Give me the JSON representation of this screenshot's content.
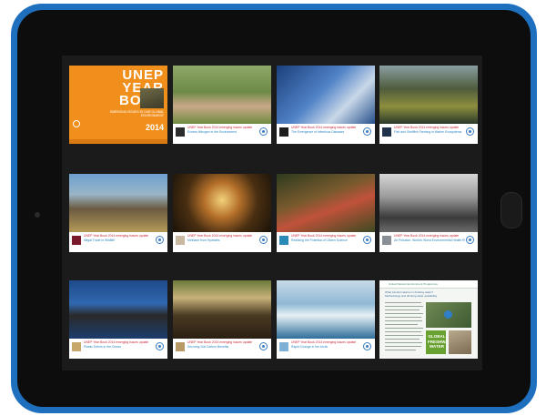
{
  "colors": {
    "frame": "#1f6fbf",
    "bezel": "#0d0d0d",
    "screen": "#1b1b1b",
    "cover": "#f08f1c",
    "caption_red": "#c9283a",
    "caption_blue": "#2e86c1"
  },
  "cover": {
    "title_lines": [
      "UNEP",
      "YEAR",
      "BOOK"
    ],
    "subtitle": "EMERGING ISSUES IN OUR GLOBAL ENVIRONMENT",
    "year": "2014"
  },
  "tiles": [
    {
      "series": "UNEP Year Book 2014 emerging issues update",
      "topic": "Excess Nitrogen in the Environment",
      "accent": "#2b2b2b",
      "photo": "linear-gradient(180deg,#8fa86a 0%,#6d8a46 45%,#c9a98a 70%,#6f8c3f 100%)"
    },
    {
      "series": "UNEP Year Book 2014 emerging issues update",
      "topic": "The Emergence of Infectious Diseases",
      "accent": "#1c1c1c",
      "photo": "linear-gradient(135deg,#1c3f7c 0%,#4f82c6 45%,#c8d8e8 70%,#26508c 100%)"
    },
    {
      "series": "UNEP Year Book 2014 emerging issues update",
      "topic": "Fish and Shellfish Farming in Marine Ecosystems",
      "accent": "#20324a",
      "photo": "linear-gradient(180deg,#8a9fa2 0%,#4f5b3c 40%,#8d8f3e 70%,#2b3a2a 100%)"
    },
    {
      "series": "UNEP Year Book 2014 emerging issues update",
      "topic": "Illegal Trade in Wildlife",
      "accent": "#7b1a2a",
      "photo": "linear-gradient(180deg,#6ea0d0 0%,#9ab6c8 35%,#6a5a40 60%,#b59a58 100%)"
    },
    {
      "series": "UNEP Year Book 2014 emerging issues update",
      "topic": "Methane from Hydrates",
      "accent": "#c9b9a0",
      "photo": "radial-gradient(circle at 50% 45%,#f3d27a 0%,#b5702a 30%,#4a2f12 60%,#1a1208 100%)"
    },
    {
      "series": "UNEP Year Book 2014 emerging issues update",
      "topic": "Realizing the Potential of Citizen Science",
      "accent": "#2b8ab7",
      "photo": "linear-gradient(160deg,#2d3b1e 0%,#7a5a2e 40%,#c0523a 60%,#3d4a22 100%)"
    },
    {
      "series": "UNEP Year Book 2014 emerging issues update",
      "topic": "Air Pollution: World's Worst Environmental Health Risk",
      "accent": "#8a8f96",
      "photo": "linear-gradient(180deg,#d6d6d6 0%,#9a9a9a 40%,#3b3b3b 75%,#6a6a6a 100%)"
    },
    {
      "series": "UNEP Year Book 2014 emerging issues update",
      "topic": "Plastic Debris in the Ocean",
      "accent": "#c7a86a",
      "photo": "linear-gradient(180deg,#1e4a8a 0%,#3068b0 40%,#2a2a2a 60%,#1c3d6e 100%)"
    },
    {
      "series": "UNEP Year Book 2014 emerging issues update",
      "topic": "Securing Soil Carbon Benefits",
      "accent": "#b79a66",
      "photo": "linear-gradient(180deg,#6a7a3a 0%,#c7b27a 30%,#4a3a22 60%,#2a1f12 100%)"
    },
    {
      "series": "UNEP Year Book 2014 emerging issues update",
      "topic": "Rapid Change in the Arctic",
      "accent": "#7fb1d6",
      "photo": "linear-gradient(180deg,#c8dbe8 0%,#8fb8d6 40%,#e6f0f4 60%,#2f6e9a 100%)"
    }
  ],
  "document": {
    "header": "United Nations Environment Programme",
    "title": "What transformations in drinking water? Methodology and drinking water availability",
    "badge_lines": [
      "GLOBAL",
      "FRESHWATER",
      "WATER"
    ]
  }
}
